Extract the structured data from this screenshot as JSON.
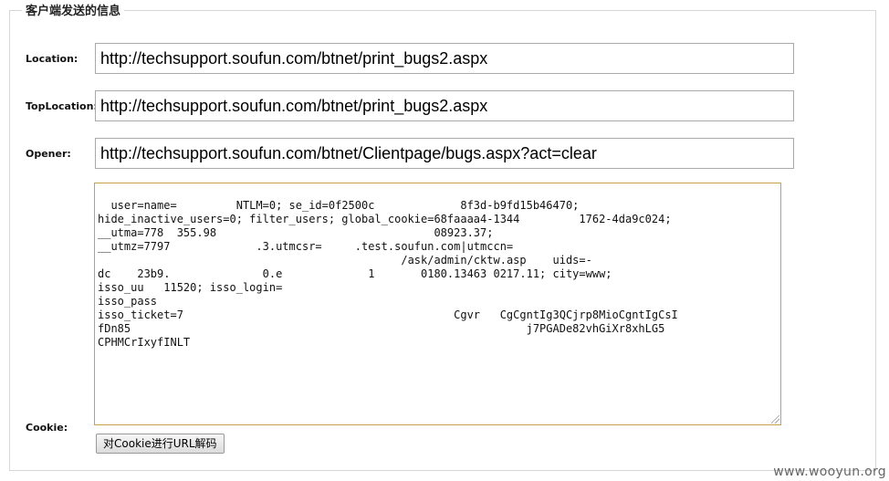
{
  "section": {
    "legend": "客户端发送的信息"
  },
  "fields": {
    "location": {
      "label": "Location:",
      "value": "http://techsupport.soufun.com/btnet/print_bugs2.aspx"
    },
    "top_location": {
      "label": "TopLocation:",
      "value": "http://techsupport.soufun.com/btnet/print_bugs2.aspx"
    },
    "opener": {
      "label": "Opener:",
      "value": "http://techsupport.soufun.com/btnet/Clientpage/bugs.aspx?act=clear"
    },
    "cookie": {
      "label": "Cookie:",
      "value": "user=name=         NTLM=0; se_id=0f2500c             8f3d-b9fd15b46470;\nhide_inactive_users=0; filter_users; global_cookie=68faaaa4-1344         1762-4da9c024;\n__utma=778  355.98                                 08923.37;\n__utmz=7797             .3.utmcsr=     .test.soufun.com|utmccn=\n                                              /ask/admin/cktw.asp    uids=-\ndc    23b9.              0.e             1       0180.13463 0217.11; city=www;\nisso_uu   11520; isso_login=\nisso_pass\nisso_ticket=7                                         Cgvr   CgCgntIg3QCjrp8MioCgntIgCsI\nfDn85                                                            j7PGADe82vhGiXr8xhLG5\nCPHMCrIxyfINLT"
    }
  },
  "buttons": {
    "decode_cookie": "对Cookie进行URL解码"
  },
  "watermark": "www.wooyun.org"
}
